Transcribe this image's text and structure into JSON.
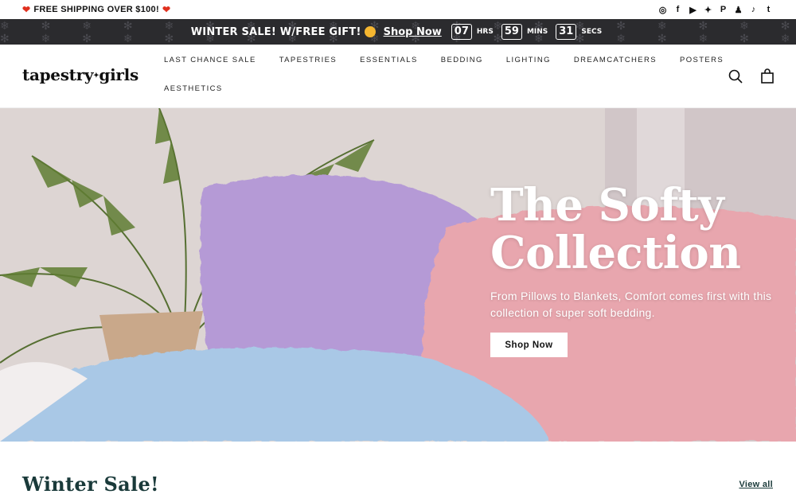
{
  "topbar": {
    "shipping_text": "FREE SHIPPING OVER $100!",
    "social": [
      {
        "icon": "instagram-icon",
        "glyph": "◎"
      },
      {
        "icon": "facebook-icon",
        "glyph": "f"
      },
      {
        "icon": "youtube-icon",
        "glyph": "▶"
      },
      {
        "icon": "twitter-icon",
        "glyph": "✦"
      },
      {
        "icon": "pinterest-icon",
        "glyph": "P"
      },
      {
        "icon": "snapchat-icon",
        "glyph": "♟"
      },
      {
        "icon": "tiktok-icon",
        "glyph": "♪"
      },
      {
        "icon": "tumblr-icon",
        "glyph": "t"
      }
    ]
  },
  "promo": {
    "text": "WINTER SALE! W/FREE GIFT!",
    "link": "Shop Now",
    "countdown": [
      {
        "value": "07",
        "unit": "HRS"
      },
      {
        "value": "59",
        "unit": "MINS"
      },
      {
        "value": "31",
        "unit": "SECS"
      }
    ],
    "background": "#2b2b2e"
  },
  "header": {
    "logo_left": "tapestry",
    "logo_right": "girls",
    "nav_row1": [
      "LAST CHANCE SALE",
      "TAPESTRIES",
      "ESSENTIALS",
      "BEDDING",
      "LIGHTING",
      "DREAMCATCHERS",
      "POSTERS"
    ],
    "nav_row2": [
      "AESTHETICS"
    ]
  },
  "hero": {
    "title_line1": "The Softy",
    "title_line2": "Collection",
    "subtitle": "From Pillows to Blankets, Comfort comes first with this collection of super soft bedding.",
    "button": "Shop Now"
  },
  "section": {
    "title": "Winter Sale!",
    "view_all": "View all"
  },
  "colors": {
    "accent_teal": "#1a3a3a",
    "heart_red": "#e0301e",
    "pillow_purple": "#b59ad6",
    "pillow_blue": "#a9c8e6",
    "pillow_pink": "#e8a6ae"
  }
}
